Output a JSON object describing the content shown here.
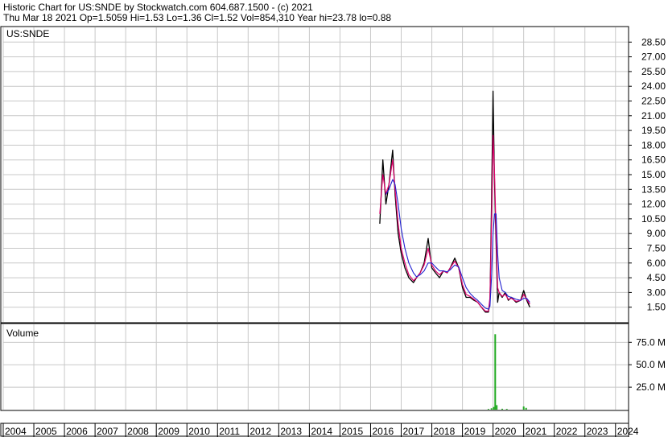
{
  "header": {
    "line1": "Historic Chart for US:SNDE by Stockwatch.com 604.687.1500 - (c) 2021",
    "line2": "Thu Mar 18 2021   Op=1.5059   Hi=1.53   Lo=1.36   Cl=1.52   Vol=854,310   Year hi=23.78   lo=0.88"
  },
  "colors": {
    "price": "#000000",
    "ma_short": "#e0006c",
    "ma_long": "#2020d0",
    "volume": "#22aa22",
    "grid": "#c8c8c8",
    "frame": "#000000"
  },
  "chart_data": [
    {
      "type": "line",
      "label": "US:SNDE",
      "y_scale": "linear",
      "ylim": [
        0,
        30
      ],
      "y_ticks": [
        "28.50",
        "27.00",
        "25.50",
        "24.00",
        "22.50",
        "21.00",
        "19.50",
        "18.00",
        "16.50",
        "15.00",
        "13.50",
        "12.00",
        "10.50",
        "9.00",
        "7.50",
        "6.00",
        "4.50",
        "3.00",
        "1.50"
      ],
      "grid": true,
      "x": [
        2016.3,
        2016.4,
        2016.5,
        2016.6,
        2016.72,
        2016.8,
        2016.9,
        2017.0,
        2017.12,
        2017.25,
        2017.4,
        2017.5,
        2017.62,
        2017.75,
        2017.88,
        2018.0,
        2018.12,
        2018.25,
        2018.38,
        2018.5,
        2018.6,
        2018.75,
        2018.88,
        2019.0,
        2019.12,
        2019.25,
        2019.38,
        2019.5,
        2019.62,
        2019.75,
        2019.85,
        2019.9,
        2019.95,
        2020.0,
        2020.05,
        2020.1,
        2020.15,
        2020.2,
        2020.3,
        2020.4,
        2020.5,
        2020.6,
        2020.75,
        2020.9,
        2021.0,
        2021.1,
        2021.2
      ],
      "series": [
        {
          "values": [
            10.0,
            16.5,
            12.0,
            14.0,
            17.5,
            13.0,
            9.0,
            7.0,
            5.5,
            4.5,
            4.0,
            4.5,
            5.0,
            6.0,
            8.5,
            5.5,
            5.0,
            4.5,
            5.2,
            5.0,
            5.5,
            6.5,
            5.5,
            3.5,
            2.5,
            2.5,
            2.2,
            2.0,
            1.5,
            1.0,
            1.0,
            2.0,
            12.0,
            23.5,
            14.0,
            8.0,
            2.0,
            3.0,
            2.5,
            3.0,
            2.2,
            2.5,
            2.0,
            2.2,
            3.2,
            2.2,
            1.5
          ]
        },
        {
          "values": [
            11.0,
            15.0,
            13.0,
            14.0,
            16.5,
            13.5,
            10.0,
            7.5,
            6.0,
            4.8,
            4.2,
            4.5,
            5.0,
            5.8,
            7.5,
            5.8,
            5.2,
            4.8,
            5.2,
            5.0,
            5.5,
            6.2,
            5.5,
            3.8,
            2.8,
            2.6,
            2.3,
            2.0,
            1.5,
            1.1,
            1.1,
            2.5,
            10.0,
            19.0,
            15.0,
            9.0,
            3.5,
            3.0,
            2.6,
            2.8,
            2.3,
            2.4,
            2.1,
            2.2,
            2.8,
            2.3,
            1.8
          ]
        },
        {
          "values": [
            null,
            null,
            13.0,
            13.5,
            14.5,
            14.0,
            12.0,
            9.5,
            7.5,
            6.0,
            5.0,
            4.6,
            4.8,
            5.2,
            6.0,
            6.0,
            5.6,
            5.2,
            5.2,
            5.1,
            5.3,
            5.8,
            5.6,
            4.5,
            3.5,
            2.9,
            2.5,
            2.2,
            1.8,
            1.4,
            1.3,
            1.6,
            4.5,
            9.0,
            11.0,
            11.0,
            7.0,
            4.5,
            3.2,
            3.0,
            2.6,
            2.5,
            2.3,
            2.2,
            2.4,
            2.4,
            2.0
          ]
        }
      ]
    },
    {
      "type": "bar",
      "label": "Volume",
      "y_ticks": [
        "75.0 M",
        "50.0 M",
        "25.0 M"
      ],
      "ylim": [
        0,
        95
      ],
      "grid": true,
      "x": [
        2019.85,
        2019.95,
        2020.02,
        2020.07,
        2020.12,
        2020.3,
        2020.45,
        2021.0,
        2021.08
      ],
      "values": [
        0.8,
        1.5,
        3.0,
        84.0,
        5.0,
        1.0,
        0.8,
        3.5,
        2.0
      ]
    },
    {
      "type": "axis",
      "x_ticks": [
        "2004",
        "2005",
        "2006",
        "2007",
        "2008",
        "2009",
        "2010",
        "2011",
        "2012",
        "2013",
        "2014",
        "2015",
        "2016",
        "2017",
        "2018",
        "2019",
        "2020",
        "2021",
        "2022",
        "2023",
        "2024"
      ]
    }
  ]
}
